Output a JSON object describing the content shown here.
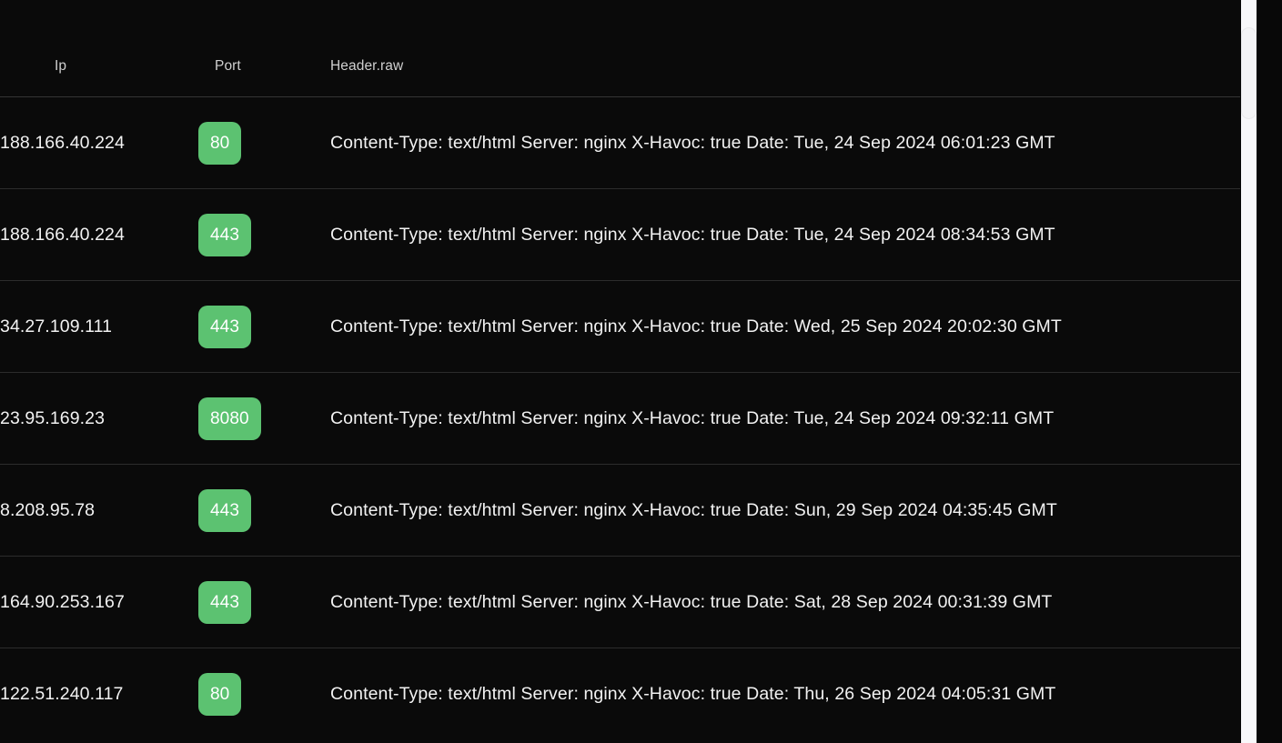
{
  "table": {
    "columns": [
      {
        "key": "ip",
        "label": "Ip"
      },
      {
        "key": "port",
        "label": "Port"
      },
      {
        "key": "raw",
        "label": "Header.raw"
      }
    ],
    "accent_color": "#5cc271",
    "rows": [
      {
        "ip": "188.166.40.224",
        "port": "80",
        "raw": "Content-Type: text/html Server: nginx X-Havoc: true Date: Tue, 24 Sep 2024 06:01:23 GMT"
      },
      {
        "ip": "188.166.40.224",
        "port": "443",
        "raw": "Content-Type: text/html Server: nginx X-Havoc: true Date: Tue, 24 Sep 2024 08:34:53 GMT"
      },
      {
        "ip": "34.27.109.111",
        "port": "443",
        "raw": "Content-Type: text/html Server: nginx X-Havoc: true Date: Wed, 25 Sep 2024 20:02:30 GMT"
      },
      {
        "ip": "23.95.169.23",
        "port": "8080",
        "raw": "Content-Type: text/html Server: nginx X-Havoc: true Date: Tue, 24 Sep 2024 09:32:11 GMT"
      },
      {
        "ip": "8.208.95.78",
        "port": "443",
        "raw": "Content-Type: text/html Server: nginx X-Havoc: true Date: Sun, 29 Sep 2024 04:35:45 GMT"
      },
      {
        "ip": "164.90.253.167",
        "port": "443",
        "raw": "Content-Type: text/html Server: nginx X-Havoc: true Date: Sat, 28 Sep 2024 00:31:39 GMT"
      },
      {
        "ip": "122.51.240.117",
        "port": "80",
        "raw": "Content-Type: text/html Server: nginx X-Havoc: true Date: Thu, 26 Sep 2024 04:05:31 GMT"
      }
    ]
  },
  "scrollbar": {
    "orientation": "vertical",
    "thumb_position_percent": 4
  }
}
